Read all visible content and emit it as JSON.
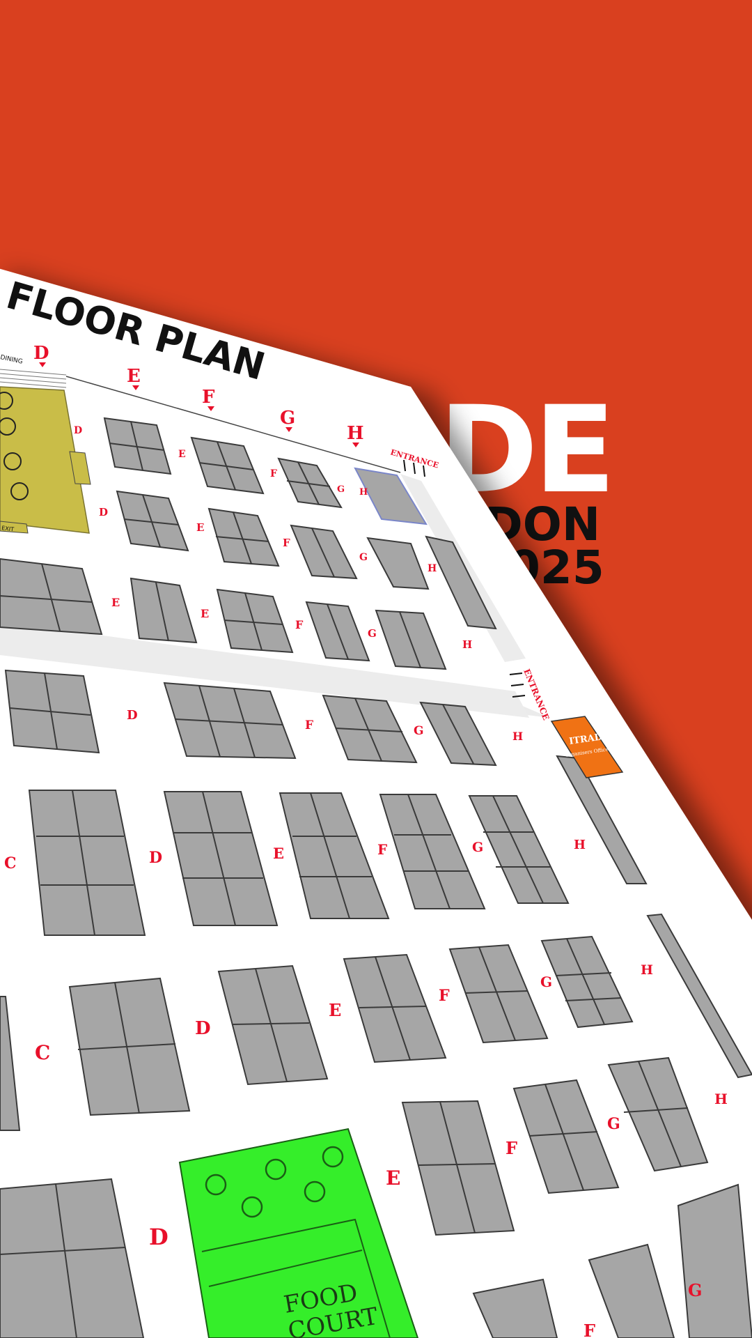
{
  "brand": {
    "headline_fragment": "DE",
    "line1_fragment": "DON",
    "line2_fragment": "025"
  },
  "floorplan": {
    "title": "FLOOR PLAN",
    "top_letters": [
      "D",
      "E",
      "F",
      "G",
      "H"
    ],
    "entrance_label": "ENTRANCE",
    "entrance_label_side": "ENTRANCE",
    "row_letters": {
      "r1": [
        "D",
        "E",
        "F",
        "G",
        "H"
      ],
      "r2": [
        "D",
        "E",
        "F",
        "G",
        "H"
      ],
      "r3": [
        "E",
        "E",
        "F",
        "G",
        "H"
      ],
      "r4": [
        "D",
        "F",
        "G",
        "H"
      ],
      "r5": [
        "C",
        "D",
        "E",
        "F",
        "G",
        "H"
      ],
      "r6": [
        "C",
        "D",
        "E",
        "F",
        "G",
        "H"
      ],
      "r7": [
        "D",
        "E",
        "F",
        "G",
        "H"
      ],
      "r8": [
        "F",
        "G"
      ]
    },
    "organiser_booth": {
      "title": "ITRADE",
      "subtitle": "Organisers Office"
    },
    "food_court_label": [
      "FOOD",
      "COURT"
    ],
    "dining_label": "DINING",
    "exit_label": "EXIT"
  },
  "colors": {
    "background": "#d9401f",
    "booth": "#a6a6a6",
    "booth_outline": "#3a3a3a",
    "food_court": "#35ee2a",
    "dining": "#c9bd48",
    "organiser": "#f07214",
    "letters": "#e8102a"
  }
}
